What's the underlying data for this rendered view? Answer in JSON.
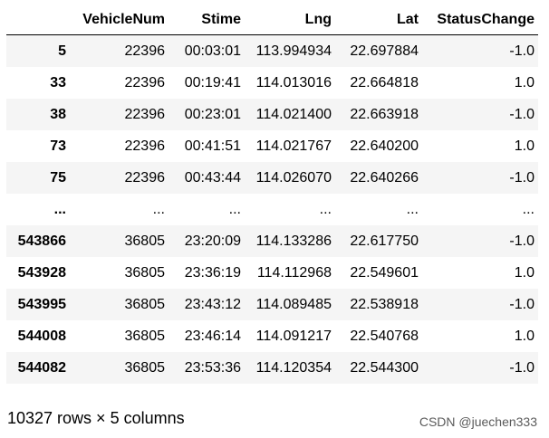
{
  "table": {
    "columns": [
      "",
      "VehicleNum",
      "Stime",
      "Lng",
      "Lat",
      "StatusChange"
    ],
    "rows": [
      {
        "index": "5",
        "VehicleNum": "22396",
        "Stime": "00:03:01",
        "Lng": "113.994934",
        "Lat": "22.697884",
        "StatusChange": "-1.0"
      },
      {
        "index": "33",
        "VehicleNum": "22396",
        "Stime": "00:19:41",
        "Lng": "114.013016",
        "Lat": "22.664818",
        "StatusChange": "1.0"
      },
      {
        "index": "38",
        "VehicleNum": "22396",
        "Stime": "00:23:01",
        "Lng": "114.021400",
        "Lat": "22.663918",
        "StatusChange": "-1.0"
      },
      {
        "index": "73",
        "VehicleNum": "22396",
        "Stime": "00:41:51",
        "Lng": "114.021767",
        "Lat": "22.640200",
        "StatusChange": "1.0"
      },
      {
        "index": "75",
        "VehicleNum": "22396",
        "Stime": "00:43:44",
        "Lng": "114.026070",
        "Lat": "22.640266",
        "StatusChange": "-1.0"
      },
      {
        "index": "...",
        "VehicleNum": "...",
        "Stime": "...",
        "Lng": "...",
        "Lat": "...",
        "StatusChange": "..."
      },
      {
        "index": "543866",
        "VehicleNum": "36805",
        "Stime": "23:20:09",
        "Lng": "114.133286",
        "Lat": "22.617750",
        "StatusChange": "-1.0"
      },
      {
        "index": "543928",
        "VehicleNum": "36805",
        "Stime": "23:36:19",
        "Lng": "114.112968",
        "Lat": "22.549601",
        "StatusChange": "1.0"
      },
      {
        "index": "543995",
        "VehicleNum": "36805",
        "Stime": "23:43:12",
        "Lng": "114.089485",
        "Lat": "22.538918",
        "StatusChange": "-1.0"
      },
      {
        "index": "544008",
        "VehicleNum": "36805",
        "Stime": "23:46:14",
        "Lng": "114.091217",
        "Lat": "22.540768",
        "StatusChange": "1.0"
      },
      {
        "index": "544082",
        "VehicleNum": "36805",
        "Stime": "23:53:36",
        "Lng": "114.120354",
        "Lat": "22.544300",
        "StatusChange": "-1.0"
      }
    ]
  },
  "shape_caption": "10327 rows × 5 columns",
  "watermark": "CSDN @juechen333",
  "colors": {
    "row_stripe": "#f5f5f5",
    "row_plain": "#ffffff",
    "header_rule": "#000000",
    "watermark": "#5a5a5a"
  }
}
